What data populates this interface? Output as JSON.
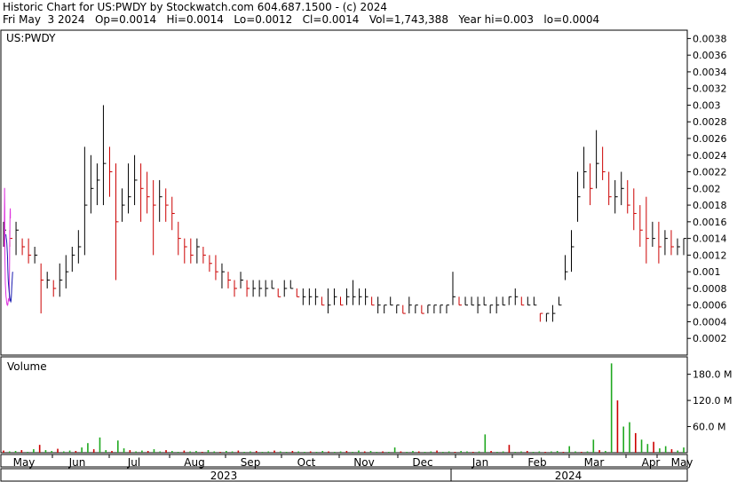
{
  "header": {
    "line1": "Historic Chart for US:PWDY by Stockwatch.com 604.687.1500 - (c) 2024",
    "line2": "Fri May  3 2024   Op=0.0014   Hi=0.0014   Lo=0.0012   Cl=0.0014   Vol=1,743,388   Year hi=0.003   lo=0.0004"
  },
  "chart_data": {
    "type": "ohlc",
    "price_panel": {
      "symbol_label": "US:PWDY",
      "ylim": [
        0,
        0.0039
      ],
      "yticks": [
        "0.0002",
        "0.0004",
        "0.0006",
        "0.0008",
        "0.001",
        "0.0012",
        "0.0014",
        "0.0016",
        "0.0018",
        "0.002",
        "0.0022",
        "0.0024",
        "0.0026",
        "0.0028",
        "0.003",
        "0.0032",
        "0.0034",
        "0.0036",
        "0.0038"
      ],
      "series": [
        {
          "kind": "ohlc",
          "color": "#000000",
          "up_color": "#000000",
          "down_color": "#cc0000"
        },
        {
          "kind": "moving_average",
          "color": "#dd33dd"
        },
        {
          "kind": "moving_average",
          "color": "#1a1ab0"
        }
      ],
      "price_bars": [
        [
          0.0016,
          0.0013,
          0.0015
        ],
        [
          0.0015,
          0.0013,
          0.0014
        ],
        [
          0.0016,
          0.0012,
          0.0015
        ],
        [
          0.0014,
          0.0012,
          0.0013
        ],
        [
          0.0014,
          0.0011,
          0.0012
        ],
        [
          0.0013,
          0.0011,
          0.0012
        ],
        [
          0.0011,
          0.0005,
          0.0009
        ],
        [
          0.001,
          0.0008,
          0.0009
        ],
        [
          0.0009,
          0.0007,
          0.0008
        ],
        [
          0.0011,
          0.0007,
          0.0009
        ],
        [
          0.0012,
          0.0008,
          0.001
        ],
        [
          0.0013,
          0.001,
          0.0012
        ],
        [
          0.0015,
          0.0011,
          0.0013
        ],
        [
          0.0025,
          0.0012,
          0.0018
        ],
        [
          0.0024,
          0.0017,
          0.002
        ],
        [
          0.0023,
          0.0018,
          0.0021
        ],
        [
          0.003,
          0.0018,
          0.0023
        ],
        [
          0.0025,
          0.0019,
          0.0022
        ],
        [
          0.0023,
          0.0009,
          0.0016
        ],
        [
          0.002,
          0.0016,
          0.0018
        ],
        [
          0.0023,
          0.0017,
          0.0019
        ],
        [
          0.0024,
          0.0018,
          0.0021
        ],
        [
          0.0023,
          0.0016,
          0.002
        ],
        [
          0.0022,
          0.0017,
          0.0019
        ],
        [
          0.0021,
          0.0012,
          0.0018
        ],
        [
          0.0021,
          0.0016,
          0.0019
        ],
        [
          0.002,
          0.0016,
          0.0018
        ],
        [
          0.0019,
          0.0015,
          0.0017
        ],
        [
          0.0016,
          0.0012,
          0.0014
        ],
        [
          0.0014,
          0.0011,
          0.0013
        ],
        [
          0.0014,
          0.0011,
          0.0012
        ],
        [
          0.0014,
          0.0011,
          0.0013
        ],
        [
          0.0013,
          0.0011,
          0.0012
        ],
        [
          0.0012,
          0.001,
          0.0011
        ],
        [
          0.0012,
          0.0009,
          0.001
        ],
        [
          0.0011,
          0.0008,
          0.001
        ],
        [
          0.001,
          0.0008,
          0.0009
        ],
        [
          0.0009,
          0.0007,
          0.0008
        ],
        [
          0.001,
          0.0008,
          0.0009
        ],
        [
          0.0009,
          0.0007,
          0.0008
        ],
        [
          0.0009,
          0.0007,
          0.0008
        ],
        [
          0.0009,
          0.0007,
          0.0008
        ],
        [
          0.0009,
          0.0007,
          0.0008
        ],
        [
          0.0009,
          0.0008,
          0.0008
        ],
        [
          0.0008,
          0.0007,
          0.0007
        ],
        [
          0.0009,
          0.0007,
          0.0008
        ],
        [
          0.0009,
          0.0008,
          0.0008
        ],
        [
          0.0008,
          0.0007,
          0.0007
        ],
        [
          0.0008,
          0.0006,
          0.0007
        ],
        [
          0.0008,
          0.0006,
          0.0007
        ],
        [
          0.0008,
          0.0006,
          0.0007
        ],
        [
          0.0007,
          0.0006,
          0.0006
        ],
        [
          0.0008,
          0.0005,
          0.0006
        ],
        [
          0.0008,
          0.0006,
          0.0007
        ],
        [
          0.0007,
          0.0006,
          0.0006
        ],
        [
          0.0008,
          0.0006,
          0.0007
        ],
        [
          0.0009,
          0.0006,
          0.0007
        ],
        [
          0.0008,
          0.0006,
          0.0007
        ],
        [
          0.0008,
          0.0006,
          0.0007
        ],
        [
          0.0007,
          0.0006,
          0.0006
        ],
        [
          0.0007,
          0.0005,
          0.0006
        ],
        [
          0.0006,
          0.0005,
          0.0006
        ],
        [
          0.0007,
          0.0006,
          0.0006
        ],
        [
          0.0006,
          0.0005,
          0.0006
        ],
        [
          0.0006,
          0.0005,
          0.0005
        ],
        [
          0.0007,
          0.0005,
          0.0006
        ],
        [
          0.0006,
          0.0005,
          0.0006
        ],
        [
          0.0006,
          0.0005,
          0.0005
        ],
        [
          0.0006,
          0.0005,
          0.0006
        ],
        [
          0.0006,
          0.0005,
          0.0006
        ],
        [
          0.0006,
          0.0005,
          0.0006
        ],
        [
          0.0006,
          0.0005,
          0.0006
        ],
        [
          0.001,
          0.0006,
          0.0007
        ],
        [
          0.0007,
          0.0006,
          0.0006
        ],
        [
          0.0007,
          0.0006,
          0.0006
        ],
        [
          0.0007,
          0.0006,
          0.0006
        ],
        [
          0.0007,
          0.0005,
          0.0006
        ],
        [
          0.0007,
          0.0006,
          0.0006
        ],
        [
          0.0006,
          0.0005,
          0.0006
        ],
        [
          0.0007,
          0.0005,
          0.0006
        ],
        [
          0.0007,
          0.0006,
          0.0006
        ],
        [
          0.0007,
          0.0006,
          0.0007
        ],
        [
          0.0008,
          0.0006,
          0.0007
        ],
        [
          0.0007,
          0.0006,
          0.0006
        ],
        [
          0.0007,
          0.0006,
          0.0006
        ],
        [
          0.0007,
          0.0006,
          0.0006
        ],
        [
          0.0005,
          0.0004,
          0.0005
        ],
        [
          0.0005,
          0.0004,
          0.0005
        ],
        [
          0.0006,
          0.0004,
          0.0005
        ],
        [
          0.0007,
          0.0006,
          0.0006
        ],
        [
          0.0012,
          0.0009,
          0.001
        ],
        [
          0.0015,
          0.001,
          0.0013
        ],
        [
          0.0022,
          0.0016,
          0.0019
        ],
        [
          0.0025,
          0.002,
          0.0022
        ],
        [
          0.0023,
          0.0018,
          0.002
        ],
        [
          0.0027,
          0.002,
          0.0023
        ],
        [
          0.0025,
          0.0021,
          0.0022
        ],
        [
          0.0022,
          0.0018,
          0.0019
        ],
        [
          0.0021,
          0.0017,
          0.0019
        ],
        [
          0.0022,
          0.0018,
          0.002
        ],
        [
          0.0021,
          0.0017,
          0.0018
        ],
        [
          0.002,
          0.0015,
          0.0017
        ],
        [
          0.0018,
          0.0013,
          0.0015
        ],
        [
          0.0019,
          0.0011,
          0.0014
        ],
        [
          0.0016,
          0.0013,
          0.0014
        ],
        [
          0.0016,
          0.0011,
          0.0013
        ],
        [
          0.0015,
          0.0012,
          0.0014
        ],
        [
          0.0015,
          0.0012,
          0.0013
        ],
        [
          0.0014,
          0.0012,
          0.0013
        ],
        [
          0.0014,
          0.0012,
          0.0014
        ]
      ],
      "ma_short": [
        [
          0.00095,
          0.0013
        ],
        [
          0.00105,
          0.00139
        ],
        [
          0.00115,
          0.00149
        ],
        [
          0.0013,
          0.00165
        ],
        [
          0.0014,
          0.00176
        ],
        [
          0.00146,
          0.0019
        ],
        [
          0.00153,
          0.002
        ],
        [
          0.0016,
          0.002
        ],
        [
          0.0017,
          0.00195
        ],
        [
          0.00185,
          0.00175
        ],
        [
          0.0019,
          0.00165
        ],
        [
          0.002,
          0.0014
        ],
        [
          0.0021,
          0.00123
        ],
        [
          0.00225,
          0.00113
        ],
        [
          0.0024,
          0.00103
        ],
        [
          0.00255,
          0.00092
        ],
        [
          0.0027,
          0.00086
        ],
        [
          0.003,
          0.00082
        ],
        [
          0.0033,
          0.00078
        ],
        [
          0.0036,
          0.00073
        ],
        [
          0.0039,
          0.0007
        ],
        [
          0.0043,
          0.00068
        ],
        [
          0.0047,
          0.00064
        ],
        [
          0.0051,
          0.00062
        ],
        [
          0.0055,
          0.0006
        ],
        [
          0.0059,
          0.00061
        ],
        [
          0.0063,
          0.0006
        ],
        [
          0.0067,
          0.00061
        ],
        [
          0.007,
          0.00064
        ],
        [
          0.0074,
          0.00066
        ],
        [
          0.0078,
          0.00068
        ],
        [
          0.0082,
          0.00065
        ],
        [
          0.0086,
          0.00065
        ],
        [
          0.0089,
          0.0007
        ],
        [
          0.0091,
          0.0009
        ],
        [
          0.0093,
          0.00112
        ],
        [
          0.0095,
          0.00132
        ],
        [
          0.0097,
          0.00148
        ],
        [
          0.0099,
          0.0016
        ],
        [
          0.0101,
          0.00172
        ],
        [
          0.0103,
          0.00176
        ],
        [
          0.0104,
          0.00175
        ],
        [
          0.0105,
          0.0017
        ],
        [
          0.0106,
          0.00164
        ]
      ],
      "ma_long": [
        [
          0.0036,
          0.00145
        ],
        [
          0.0041,
          0.00141
        ],
        [
          0.0046,
          0.00138
        ],
        [
          0.0051,
          0.00134
        ],
        [
          0.0056,
          0.00126
        ],
        [
          0.0061,
          0.00117
        ],
        [
          0.0066,
          0.00103
        ],
        [
          0.0071,
          0.00092
        ],
        [
          0.0076,
          0.00086
        ],
        [
          0.0081,
          0.00081
        ],
        [
          0.0086,
          0.00076
        ],
        [
          0.0091,
          0.00073
        ],
        [
          0.0095,
          0.0007
        ],
        [
          0.0099,
          0.00068
        ],
        [
          0.0103,
          0.00066
        ],
        [
          0.0107,
          0.00065
        ],
        [
          0.0111,
          0.00064
        ],
        [
          0.0115,
          0.00065
        ],
        [
          0.0119,
          0.00069
        ],
        [
          0.0123,
          0.00076
        ],
        [
          0.0127,
          0.00083
        ],
        [
          0.0131,
          0.00088
        ],
        [
          0.0135,
          0.00094
        ],
        [
          0.0139,
          0.00098
        ],
        [
          0.0141,
          0.001
        ]
      ]
    },
    "volume_panel": {
      "label": "Volume",
      "ylim": [
        0,
        220
      ],
      "yticks": [
        "60.0 M",
        "120.0 M",
        "180.0 M"
      ],
      "volumes_millions": [
        5,
        3,
        4,
        6,
        2,
        8,
        18,
        6,
        4,
        9,
        3,
        5,
        4,
        12,
        22,
        8,
        35,
        6,
        4,
        28,
        10,
        6,
        3,
        5,
        4,
        8,
        3,
        6,
        4,
        2,
        5,
        3,
        4,
        2,
        6,
        3,
        2,
        4,
        3,
        5,
        2,
        3,
        4,
        2,
        3,
        5,
        3,
        2,
        4,
        3,
        2,
        3,
        2,
        4,
        3,
        2,
        3,
        4,
        2,
        5,
        3,
        4,
        2,
        3,
        2,
        12,
        3,
        2,
        4,
        3,
        2,
        3,
        5,
        2,
        3,
        2,
        4,
        3,
        2,
        3,
        42,
        4,
        2,
        3,
        18,
        2,
        3,
        4,
        2,
        3,
        2,
        3,
        4,
        2,
        15,
        3,
        2,
        3,
        30,
        6,
        4,
        205,
        120,
        60,
        70,
        45,
        30,
        20,
        25,
        10,
        15,
        8,
        5,
        12
      ],
      "volume_colors": [
        "#1fa81f",
        "#cc0000"
      ]
    },
    "x_axis": {
      "months": [
        "May",
        "Jun",
        "Jul",
        "Aug",
        "Sep",
        "Oct",
        "Nov",
        "Dec",
        "Jan",
        "Feb",
        "Mar",
        "Apr",
        "May"
      ],
      "years": [
        "2023",
        "2024"
      ]
    }
  }
}
